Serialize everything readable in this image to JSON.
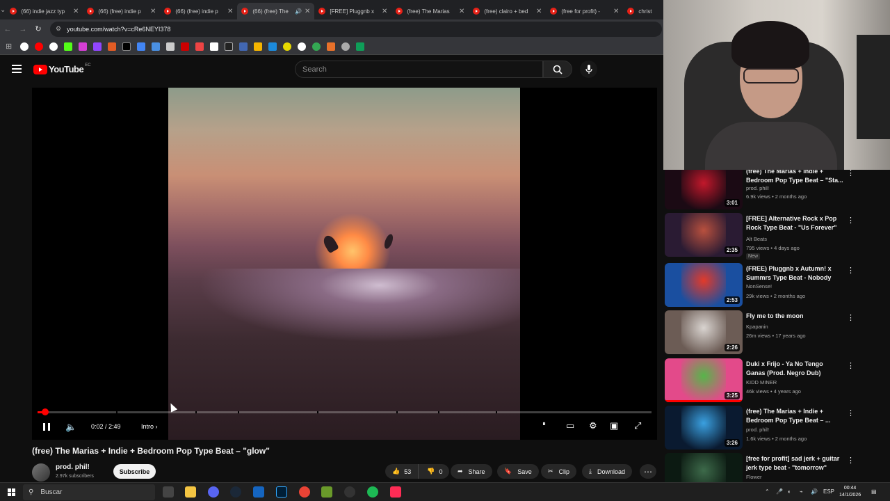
{
  "browser": {
    "tabs": [
      {
        "title": "(66) indie jazz typ",
        "active": false
      },
      {
        "title": "(66) (free) indie p",
        "active": false
      },
      {
        "title": "(66) (free) indie p",
        "active": false
      },
      {
        "title": "(66) (free) The",
        "active": true,
        "audio": true
      },
      {
        "title": "[FREE] Pluggnb x",
        "active": false
      },
      {
        "title": "(free) The Marias",
        "active": false
      },
      {
        "title": "(free) clairo + bed",
        "active": false
      },
      {
        "title": "(free for profit) -",
        "active": false
      },
      {
        "title": "christ",
        "active": false
      }
    ],
    "url": "youtube.com/watch?v=cRe6NEYI378"
  },
  "youtube": {
    "logo_text": "YouTube",
    "country": "EC",
    "search_placeholder": "Search"
  },
  "player": {
    "time": "0:02 / 2:49",
    "chapter": "Intro",
    "progress_fraction": 0.012,
    "hd_badge": "HD"
  },
  "video": {
    "title": "(free) The Marias + Indie + Bedroom Pop Type Beat – \"glow\"",
    "channel": "prod. phil!",
    "subscribers": "2.97k subscribers",
    "subscribe_label": "Subscribe",
    "likes": "53",
    "dislikes": "0",
    "share_label": "Share",
    "save_label": "Save",
    "clip_label": "Clip",
    "download_label": "Download"
  },
  "sidebar": {
    "items": [
      {
        "title": "(free) The Marias + Indie + Bedroom Pop Type Beat – \"Sta...",
        "channel": "prod. phil!",
        "meta": "6.9k views • 2 months ago",
        "duration": "3:01",
        "color1": "#c2182b",
        "color2": "#1b0a14"
      },
      {
        "title": "[FREE] Alternative Rock x Pop Rock Type Beat - \"Us Forever\"",
        "channel": "Alt Beats",
        "meta": "795 views • 4 days ago",
        "duration": "2:35",
        "badge": "New",
        "color1": "#b8503e",
        "color2": "#2a1b33"
      },
      {
        "title": "(FREE) Pluggnb x Autumn! x Summrs Type Beat - Nobody",
        "channel": "NonSense!",
        "meta": "29k views • 2 months ago",
        "duration": "2:53",
        "color1": "#e23a2a",
        "color2": "#1a4fa0"
      },
      {
        "title": "Fly me to the moon",
        "channel": "Kpapanin",
        "meta": "26m views • 17 years ago",
        "duration": "2:26",
        "color1": "#d9d4d0",
        "color2": "#6c5c55"
      },
      {
        "title": "Duki x Frijo - Ya No Tengo Ganas (Prod. Negro Dub)",
        "channel": "KIDD MINER",
        "meta": "46k views • 4 years ago",
        "duration": "3:25",
        "color1": "#57b54a",
        "color2": "#e34a8a"
      },
      {
        "title": "(free) The Marias + Indie + Bedroom Pop Type Beat – ...",
        "channel": "prod. phil!",
        "meta": "1.6k views • 2 months ago",
        "duration": "3:26",
        "color1": "#3aa0e0",
        "color2": "#0a1a30"
      },
      {
        "title": "[free for profit] sad jerk + guitar jerk type beat - \"tomorrow\"",
        "channel": "Flower",
        "meta": "",
        "duration": "",
        "color1": "#3d6a4a",
        "color2": "#0c1a12"
      }
    ]
  },
  "taskbar": {
    "search_label": "Buscar",
    "lang": "ESP",
    "time": "00:44",
    "date": "14/1/2026"
  }
}
